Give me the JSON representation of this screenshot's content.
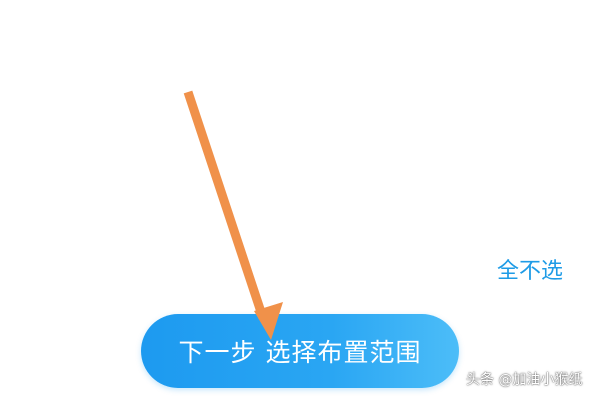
{
  "actions": {
    "deselect_all_label": "全不选",
    "next_step_label": "下一步 选择布置范围"
  },
  "watermark": {
    "text": "头条 @加油小猴纸"
  },
  "colors": {
    "accent": "#1e9be6",
    "button_gradient_start": "#1d9af0",
    "button_gradient_end": "#4cbdf8",
    "annotation_arrow": "#f0914a"
  },
  "icons": {
    "annotation": "arrow-down-icon"
  }
}
